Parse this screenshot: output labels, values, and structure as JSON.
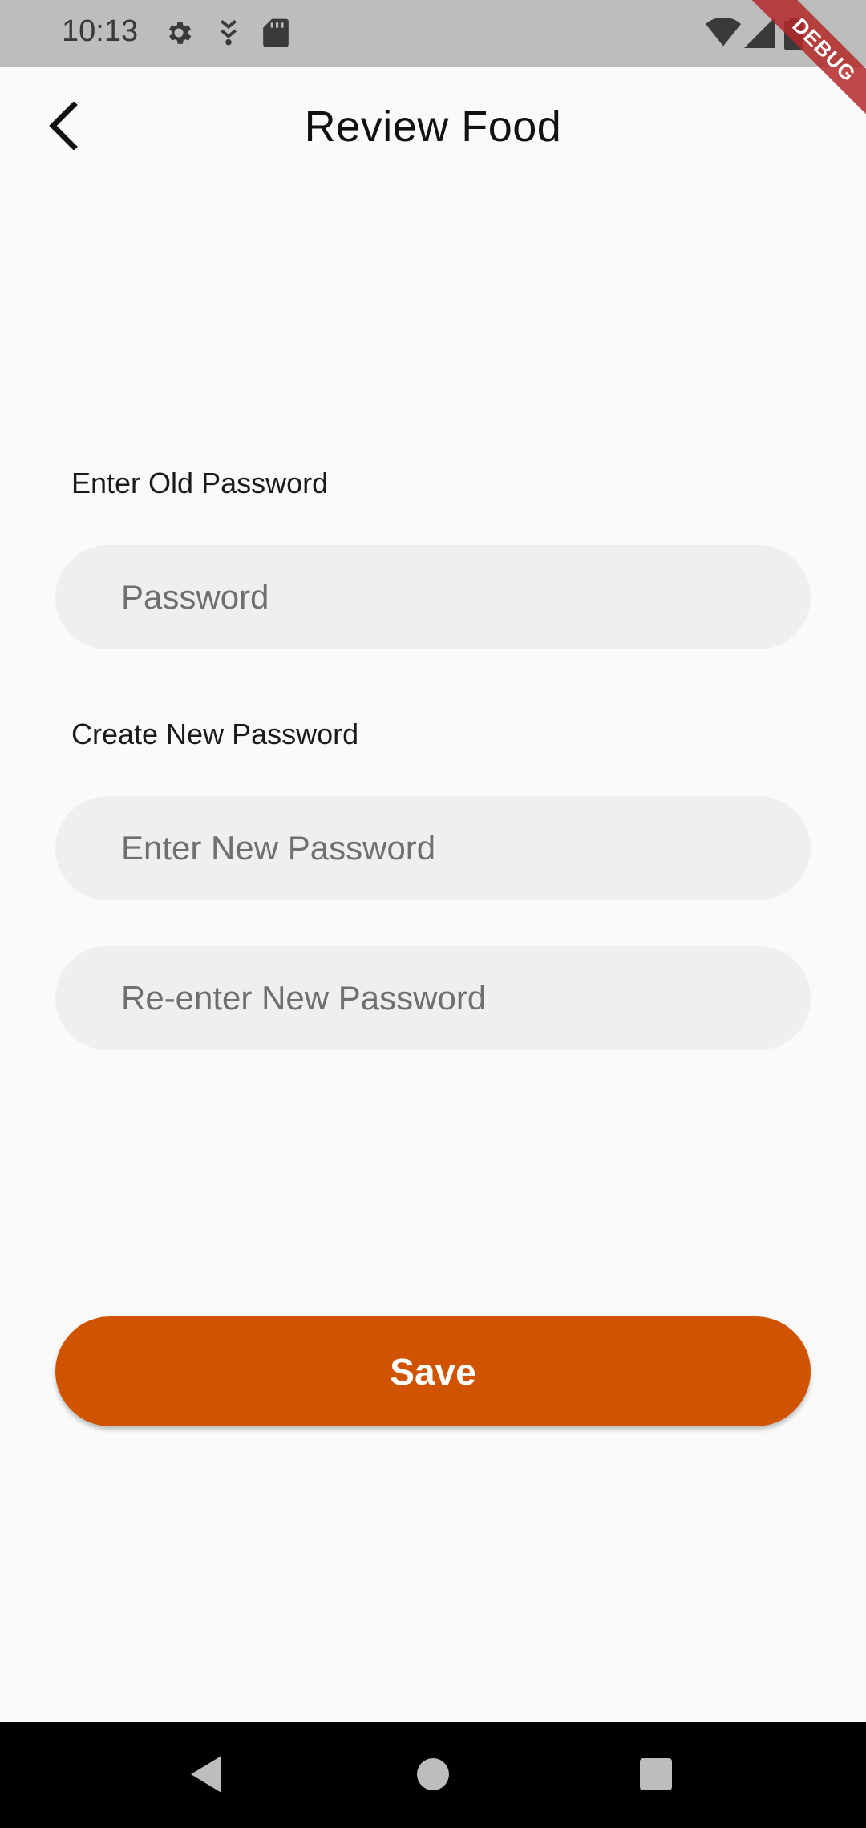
{
  "status_bar": {
    "time": "10:13",
    "icons": [
      "gear-icon",
      "download-icon",
      "sd-card-icon",
      "wifi-icon",
      "signal-icon",
      "battery-icon"
    ]
  },
  "debug_banner": "DEBUG",
  "app_bar": {
    "title": "Review Food",
    "back_icon": "chevron-left-icon"
  },
  "form": {
    "old_password_label": "Enter Old Password",
    "old_password_placeholder": "Password",
    "old_password_value": "",
    "new_password_label": "Create New Password",
    "new_password_placeholder": "Enter New Password",
    "new_password_value": "",
    "reenter_placeholder": "Re-enter New Password",
    "reenter_value": ""
  },
  "save_button": {
    "label": "Save",
    "color": "#d05400"
  },
  "nav_bar": {
    "icons": [
      "nav-back-icon",
      "nav-home-icon",
      "nav-recents-icon"
    ]
  }
}
